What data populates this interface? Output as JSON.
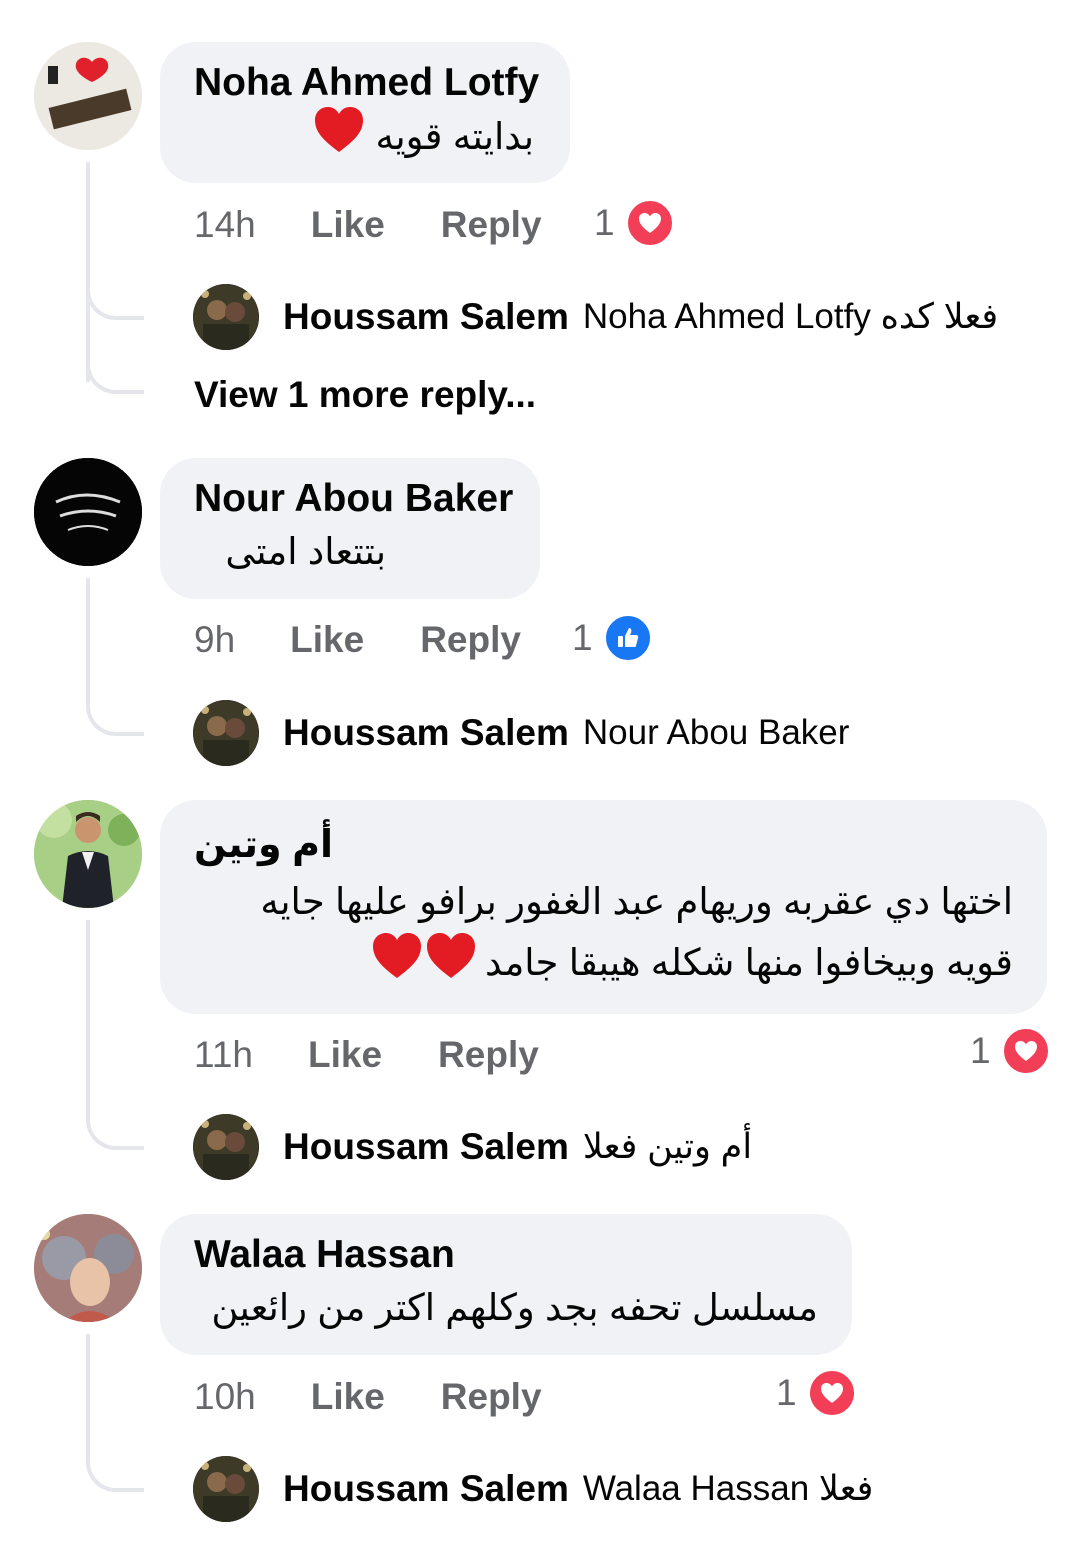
{
  "comments": [
    {
      "author": "Noha Ahmed Lotfy",
      "text": "بدايته قويه",
      "time": "14h",
      "like": "Like",
      "reply": "Reply",
      "reaction_count": "1",
      "reaction": "heart-icon",
      "reply_preview": {
        "author": "Houssam Salem",
        "text": "Noha Ahmed Lotfy فعلا كده"
      },
      "view_more": "View 1 more reply..."
    },
    {
      "author": "Nour Abou Baker",
      "text": "بتتعاد امتى",
      "time": "9h",
      "like": "Like",
      "reply": "Reply",
      "reaction_count": "1",
      "reaction": "thumbs-up-icon",
      "reply_preview": {
        "author": "Houssam Salem",
        "text": "Nour Abou Baker"
      }
    },
    {
      "author": "أم وتين",
      "text_line1": "اختها دي عقربه وريهام عبد الغفور برافو عليها جايه",
      "text_line2": "قويه وبيخافوا منها شكله هيبقا جامد",
      "time": "11h",
      "like": "Like",
      "reply": "Reply",
      "reaction_count": "1",
      "reaction": "heart-icon",
      "reply_preview": {
        "author": "Houssam Salem",
        "text": "أم وتين فعلا"
      }
    },
    {
      "author": "Walaa Hassan",
      "text": "مسلسل تحفه بجد وكلهم اكتر من رائعين",
      "time": "10h",
      "like": "Like",
      "reply": "Reply",
      "reaction_count": "1",
      "reaction": "heart-icon",
      "reply_preview": {
        "author": "Houssam Salem",
        "text": "Walaa Hassan فعلا"
      }
    }
  ],
  "colors": {
    "bubble": "#f0f2f5",
    "meta": "#65676b",
    "heart": "#f33e58",
    "like_blue": "#1877f2"
  }
}
